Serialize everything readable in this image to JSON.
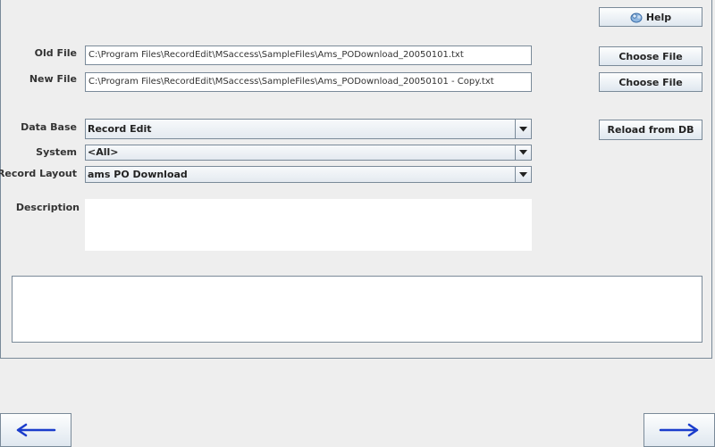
{
  "toolbar": {
    "help_label": "Help"
  },
  "form": {
    "old_file": {
      "label": "Old File",
      "value": "C:\\Program Files\\RecordEdit\\MSaccess\\SampleFiles\\Ams_PODownload_20050101.txt",
      "button": "Choose File"
    },
    "new_file": {
      "label": "New File",
      "value": "C:\\Program Files\\RecordEdit\\MSaccess\\SampleFiles\\Ams_PODownload_20050101 - Copy.txt",
      "button": "Choose File"
    },
    "database": {
      "label": "Data Base",
      "value": "Record Edit",
      "button": "Reload from DB"
    },
    "system": {
      "label": "System",
      "value": "<All>"
    },
    "record_layout": {
      "label": "Record Layout",
      "value": "ams PO Download"
    },
    "description": {
      "label": "Description",
      "value": ""
    }
  },
  "message_area": {
    "value": ""
  },
  "nav": {
    "back_icon": "left-arrow-icon",
    "forward_icon": "right-arrow-icon"
  },
  "colors": {
    "accent": "#1a3ccc",
    "border": "#7a8a99",
    "background": "#eeeeee"
  }
}
